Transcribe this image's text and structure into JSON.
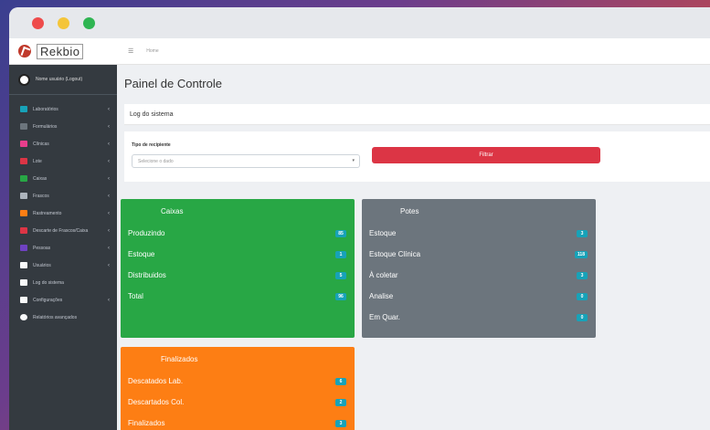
{
  "brand": {
    "name": "Rekbio"
  },
  "user": {
    "name": "Nome usuário (Logout)"
  },
  "sidebar": {
    "items": [
      {
        "label": "Laboratórios",
        "color": "#17a2b8",
        "arrow": "‹"
      },
      {
        "label": "Formulários",
        "color": "#6c757d",
        "arrow": "‹"
      },
      {
        "label": "Clínicas",
        "color": "#e83e8c",
        "arrow": "‹"
      },
      {
        "label": "Lote",
        "color": "#dc3545",
        "arrow": "‹"
      },
      {
        "label": "Caixas",
        "color": "#28a745",
        "arrow": "‹"
      },
      {
        "label": "Frascos",
        "color": "#adb5bd",
        "arrow": "‹"
      },
      {
        "label": "Rastreamento",
        "color": "#fd7e14",
        "arrow": "‹"
      },
      {
        "label": "Descarte de Frascos/Caixa",
        "color": "#dc3545",
        "arrow": "‹"
      },
      {
        "label": "Pessoas",
        "color": "#6f42c1",
        "arrow": "‹"
      },
      {
        "label": "Usuários",
        "color": "#f8f9fa",
        "arrow": "‹"
      },
      {
        "label": "Log do sistema",
        "color": "#f8f9fa",
        "arrow": ""
      },
      {
        "label": "Configurações",
        "color": "#f8f9fa",
        "arrow": "‹"
      },
      {
        "label": "Relatórios avançados",
        "color": "#f8f9fa",
        "arrow": ""
      }
    ]
  },
  "topnav": {
    "menu_icon": "☰",
    "home": "Home"
  },
  "page": {
    "title": "Painel de Controle",
    "log_card": "Log do sistema"
  },
  "filter": {
    "label": "Tipo de recipiente",
    "placeholder": "Selecione o dado",
    "caret": "▾",
    "button": "Filtrar"
  },
  "boxes": {
    "caixas": {
      "title": "Caixas",
      "rows": [
        {
          "label": "Produzindo",
          "count": "85"
        },
        {
          "label": "Estoque",
          "count": "1"
        },
        {
          "label": "Distribuidos",
          "count": "5"
        },
        {
          "label": "Total",
          "count": "96"
        }
      ]
    },
    "potes": {
      "title": "Potes",
      "rows": [
        {
          "label": "Estoque",
          "count": "3"
        },
        {
          "label": "Estoque Clínica",
          "count": "118"
        },
        {
          "label": "À coletar",
          "count": "3"
        },
        {
          "label": "Analise",
          "count": "0"
        },
        {
          "label": "Em Quar.",
          "count": "0"
        }
      ]
    },
    "finalizados": {
      "title": "Finalizados",
      "rows": [
        {
          "label": "Descatados Lab.",
          "count": "6"
        },
        {
          "label": "Descartados Col.",
          "count": "2"
        },
        {
          "label": "Finalizados",
          "count": "3"
        }
      ]
    }
  }
}
